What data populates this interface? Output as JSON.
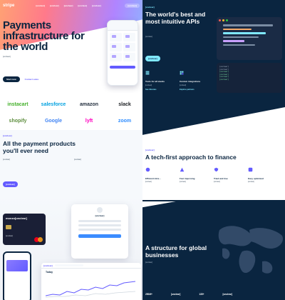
{
  "nav": {
    "logo": "stripe",
    "items": [
      "[unclear]",
      "[unclear]",
      "[unclear]",
      "[unclear]",
      "[unclear]"
    ],
    "signin": "[unclear]"
  },
  "hero": {
    "title": "Payments infrastructure for the world",
    "subtitle": "[unclear]",
    "cta_primary": "Start now",
    "cta_secondary": "Contact sales"
  },
  "brands": [
    {
      "label": "instacart",
      "color": "#43b02a"
    },
    {
      "label": "salesforce",
      "color": "#00a1e0"
    },
    {
      "label": "amazon",
      "color": "#232f3e"
    },
    {
      "label": "slack",
      "color": "#1a1d21"
    },
    {
      "label": "shopify",
      "color": "#5e8e3e"
    },
    {
      "label": "Google",
      "color": "#4285f4"
    },
    {
      "label": "lyft",
      "color": "#ff00bf"
    },
    {
      "label": "zoom",
      "color": "#2d8cff"
    }
  ],
  "products": {
    "eyebrow": "[unclear]",
    "title": "All the payment products you'll ever need",
    "desc_a": "[unclear]",
    "desc_b": "[unclear]",
    "cta": "[unclear]"
  },
  "showcase": {
    "card_name": "monzo[unclear]",
    "card_number": "[unclear]",
    "modal_title": "[unclear]",
    "dashboard_title": "Today",
    "dashboard_logo": "[unclear]"
  },
  "developers": {
    "eyebrow": "[unclear]",
    "title": "The world's best and most intuitive APIs",
    "description": "[unclear]",
    "cta": "[unclear]",
    "features": [
      {
        "title": "Tools for all stacks",
        "description": "[unclear]",
        "link": "See libraries"
      },
      {
        "title": "Custom integrations",
        "description": "[unclear]",
        "link": "Explore partners"
      }
    ],
    "terminal": [
      "[unclear]",
      "[unclear]",
      "[unclear]",
      "[unclear]",
      "[unclear]",
      "[unclear]"
    ]
  },
  "tech": {
    "eyebrow": "[unclear]",
    "title": "A tech-first approach to finance",
    "columns": [
      {
        "title": "Efficient intra...",
        "description": "[unclear]",
        "icon": "efficiency-icon"
      },
      {
        "title": "Fast improving",
        "description": "[unclear]",
        "icon": "speed-icon"
      },
      {
        "title": "Tried and true",
        "description": "[unclear]",
        "icon": "shield-icon"
      },
      {
        "title": "Easy optimized",
        "description": "[unclear]",
        "icon": "optimize-icon"
      }
    ]
  },
  "world": {
    "title": "A structure for global businesses",
    "description": "[unclear]",
    "stats": [
      "250M+",
      "[unclear]",
      "135+",
      "[unclear]"
    ]
  },
  "colors": {
    "brand": "#635bff",
    "navy": "#0a2540",
    "cyan": "#80e9ff",
    "bg_light": "#f6f9fc"
  }
}
